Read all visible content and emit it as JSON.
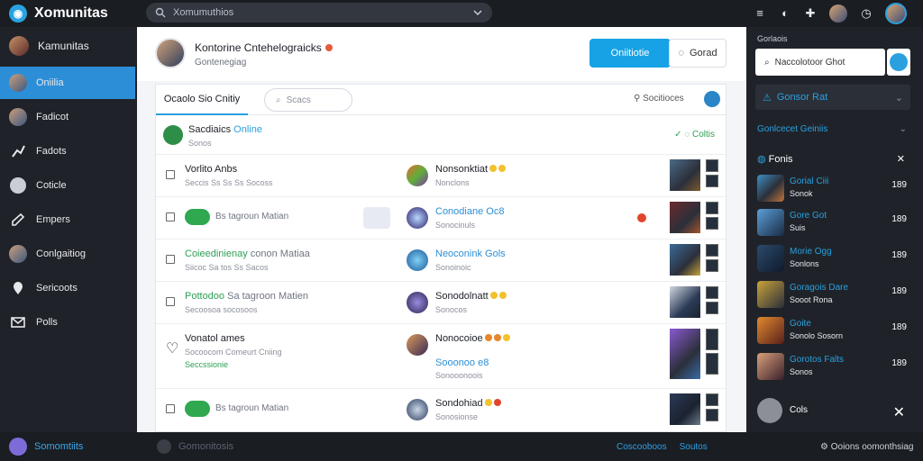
{
  "app": {
    "title": "Xomunitas"
  },
  "topbar": {
    "search_placeholder": "Xomumuthios",
    "icons": [
      "menu-icon",
      "controller-icon",
      "puzzle-icon",
      "avatar",
      "clock-icon",
      "profile-avatar"
    ]
  },
  "sidebar": {
    "profile_label": "Kamunitas",
    "items": [
      {
        "label": "Oniilia",
        "icon": "avatar",
        "active": true
      },
      {
        "label": "Fadicot",
        "icon": "avatar"
      },
      {
        "label": "Fadots",
        "icon": "dance-icon"
      },
      {
        "label": "Coticle",
        "icon": "chat-icon"
      },
      {
        "label": "Empers",
        "icon": "edit-icon"
      },
      {
        "label": "Conlgaitiog",
        "icon": "avatar"
      },
      {
        "label": "Sericoots",
        "icon": "location-icon"
      },
      {
        "label": "Polls",
        "icon": "mail-icon"
      }
    ]
  },
  "header": {
    "title": "Kontorine Cntehelograicks",
    "subtitle": "Gontenegiag",
    "primary_button": "Oniitiotie",
    "secondary_button": "Gorad"
  },
  "tabs": {
    "active_label": "Ocaolo Sio Cnitiy",
    "search_placeholder": "Scacs",
    "filter_label": "Socitioces"
  },
  "online": {
    "title": "Sacdiaics",
    "title_accent": "Online",
    "subtitle": "Sonos",
    "right_label": "Coltis"
  },
  "rows": [
    {
      "name": "Vorlito Anbs",
      "sub": "Seccis Ss Ss Ss Socoss",
      "game": "Nonsonktiat",
      "game_sub": "Nonclons",
      "variant": "text"
    },
    {
      "name": "",
      "sub": "",
      "pill_text": "Bs tagroun Matian",
      "game": "Conodiane Oc8",
      "game_sub": "Sonocinuls",
      "variant": "pill",
      "red_dot": true
    },
    {
      "name": "Coieedinienay",
      "name2": "conon Matiaa",
      "sub": "Siicoc Sa tos Ss Sacos",
      "game": "Neoconink Gols",
      "game_sub": "Sonoinoic",
      "variant": "text-green"
    },
    {
      "name": "Pottodoo",
      "name2": "Sa tagroon Matien",
      "sub": "Secoosoa socosoos",
      "game": "Sonodolnatt",
      "game_sub": "Sonocos",
      "variant": "text-green-b"
    },
    {
      "name": "Vonatol ames",
      "sub": "Socoocom Comeurt Cniing",
      "sub2": "Seccssionie",
      "game": "Nonocoioe",
      "game2": "Sooonoo e8",
      "game_sub": "Sonooonoois",
      "variant": "double"
    },
    {
      "name": "",
      "sub": "",
      "pill_text": "Bs tagroun Matian",
      "game": "Sondohiad",
      "game_sub": "Sonosionse",
      "variant": "pill"
    }
  ],
  "rpanel": {
    "label": "Gorlaois",
    "search_placeholder": "Naccolotoor Ghot",
    "dropdown": "Gonsor Rat",
    "sub_label": "Gonlcecet Geiniis",
    "section_title": "Fonis",
    "friends": [
      {
        "name": "Gorial Ciii",
        "status": "Sonok",
        "count": "189"
      },
      {
        "name": "Gore Got",
        "status": "Suis",
        "count": "189"
      },
      {
        "name": "Morie Ogg",
        "status": "Sonlons",
        "count": "189"
      },
      {
        "name": "Goragois Dare",
        "status": "Sooot Rona",
        "count": "189"
      },
      {
        "name": "Goite",
        "status": "Sonolo Sosorn",
        "count": "189"
      },
      {
        "name": "Gorotos Falts",
        "status": "Sonos",
        "count": "189"
      }
    ],
    "group_label": "Cols"
  },
  "bottombar": {
    "left_label": "Somomtiits",
    "mid_label": "Gomonitosis",
    "link1": "Coscooboos",
    "link2": "Soutos",
    "right_label": "Ooions oomonthsiag"
  },
  "colors": {
    "accent": "#2aa0df",
    "sidebar": "#1f2228",
    "online": "#2e9f56"
  }
}
